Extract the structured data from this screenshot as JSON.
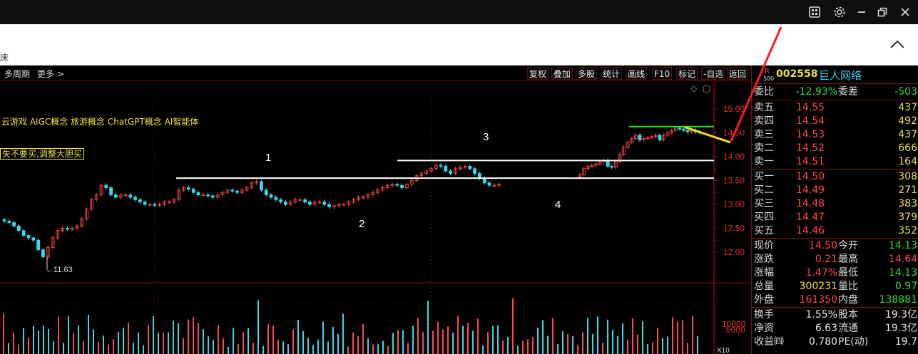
{
  "window": {
    "icons": [
      "grid-icon",
      "gear-icon",
      "minimize-icon",
      "restore-icon",
      "close-icon"
    ],
    "band_text": "床",
    "collapse_icon": "chevron-up-icon"
  },
  "toolbar": {
    "left": [
      "多周期",
      "更多 >"
    ],
    "tools": [
      "复权",
      "叠加",
      "多股",
      "统计",
      "画线",
      "F10",
      "标记",
      "-自选",
      "返回"
    ],
    "active": "画线"
  },
  "chart": {
    "concepts_text": "云游戏 AIGC概念 旅游概念 ChatGPT概念 AI智能体",
    "note_text": "失不要买,调整大胆买",
    "annotations": [
      "1",
      "2",
      "3",
      "4"
    ],
    "low_label": "←11.63",
    "y_ticks": [
      "15.00",
      "14.50",
      "14.00",
      "13.50",
      "13.00",
      "12.50",
      "12.00"
    ],
    "vol_ticks": [
      "10000",
      "5000"
    ],
    "vol_unit": "X10"
  },
  "chart_data": {
    "type": "line",
    "title": "",
    "ylim": [
      11.6,
      15.3
    ],
    "y_ticks": [
      15.0,
      14.5,
      14.0,
      13.5,
      13.0,
      12.5,
      12.0
    ],
    "series": [
      {
        "values": [
          12.65,
          12.62,
          12.55,
          12.45,
          12.35,
          12.3,
          12.25,
          12.05,
          11.9,
          12.1,
          12.3,
          12.45,
          12.5,
          12.48,
          12.5,
          12.55,
          12.7,
          12.9,
          13.1,
          13.2,
          13.4,
          13.35,
          13.2,
          13.15,
          13.2,
          13.2,
          13.15,
          13.1,
          13.05,
          13.0,
          13.0,
          12.98,
          13.0,
          13.05,
          13.05,
          13.1,
          13.3,
          13.35,
          13.32,
          13.25,
          13.2,
          13.2,
          13.18,
          13.15,
          13.2,
          13.25,
          13.3,
          13.28,
          13.25,
          13.3,
          13.35,
          13.45,
          13.48,
          13.3,
          13.2,
          13.15,
          13.1,
          13.05,
          13.0,
          13.05,
          13.1,
          13.1,
          13.05,
          13.0,
          13.05,
          13.05,
          13.0,
          12.95,
          12.97,
          13.0,
          13.0,
          13.05,
          13.1,
          13.15,
          13.15,
          13.2,
          13.25,
          13.3,
          13.35,
          13.4,
          13.42,
          13.4,
          13.35,
          13.42,
          13.5,
          13.6,
          13.65,
          13.7,
          13.75,
          13.82,
          13.8,
          13.7,
          13.65,
          13.75,
          13.78,
          13.8,
          13.75,
          13.65,
          13.55,
          13.45,
          13.4,
          13.4,
          13.42
        ]
      },
      {
        "values": [
          13.62,
          13.75,
          13.8,
          13.82,
          13.85,
          13.9,
          13.92,
          13.8,
          13.78,
          13.9,
          14.05,
          14.2,
          14.3,
          14.38,
          14.45,
          14.35,
          14.38,
          14.4,
          14.42,
          14.45,
          14.35,
          14.45,
          14.5,
          14.55,
          14.6,
          14.58,
          14.55,
          14.52,
          14.55,
          14.52,
          14.5
        ]
      }
    ],
    "lines": {
      "white_long": 13.55,
      "white_short": 13.92,
      "green": 14.63,
      "yellow_from": 14.62,
      "yellow_to": 14.3
    },
    "low_marker": 11.63,
    "volume_ticks": [
      10000,
      5000
    ]
  },
  "panel": {
    "code": "002558",
    "name": "巨人网络",
    "badge_r": "R",
    "badge_num": "500",
    "weibi": {
      "label": "委比",
      "value": "-12.93%",
      "label2": "委差",
      "value2": "-503"
    },
    "sells": [
      {
        "label": "卖五",
        "price": "14.55",
        "vol": "437"
      },
      {
        "label": "卖四",
        "price": "14.54",
        "vol": "492"
      },
      {
        "label": "卖三",
        "price": "14.53",
        "vol": "437"
      },
      {
        "label": "卖二",
        "price": "14.52",
        "vol": "666"
      },
      {
        "label": "卖一",
        "price": "14.51",
        "vol": "164"
      }
    ],
    "buys": [
      {
        "label": "买一",
        "price": "14.50",
        "vol": "308"
      },
      {
        "label": "买二",
        "price": "14.49",
        "vol": "271"
      },
      {
        "label": "买三",
        "price": "14.48",
        "vol": "383"
      },
      {
        "label": "买四",
        "price": "14.47",
        "vol": "379"
      },
      {
        "label": "买五",
        "price": "14.46",
        "vol": "352"
      }
    ],
    "stats": [
      {
        "l1": "现价",
        "v1": "14.50",
        "c1": "red",
        "l2": "今开",
        "v2": "14.13",
        "c2": "green"
      },
      {
        "l1": "涨跌",
        "v1": "0.21",
        "c1": "red",
        "l2": "最高",
        "v2": "14.64",
        "c2": "red"
      },
      {
        "l1": "涨幅",
        "v1": "1.47%",
        "c1": "red",
        "l2": "最低",
        "v2": "14.13",
        "c2": "green"
      },
      {
        "l1": "总量",
        "v1": "300231",
        "c1": "yellow",
        "l2": "量比",
        "v2": "0.97",
        "c2": "green"
      },
      {
        "l1": "外盘",
        "v1": "161350",
        "c1": "red",
        "l2": "内盘",
        "v2": "138881",
        "c2": "green"
      }
    ],
    "stats2": [
      {
        "l1": "换手",
        "v1": "1.55%",
        "l2": "股本",
        "v2": "19.3亿"
      },
      {
        "l1": "净资",
        "v1": "6.63",
        "l2": "流通",
        "v2": "19.3亿"
      },
      {
        "l1": "收益㈣",
        "v1": "0.780",
        "l2": "PE(动)",
        "v2": "19.7"
      }
    ]
  },
  "colors": {
    "up": "#ff4a4a",
    "down": "#38d8e8",
    "accent_red": "#e00000",
    "panel_border": "#7a1010"
  }
}
